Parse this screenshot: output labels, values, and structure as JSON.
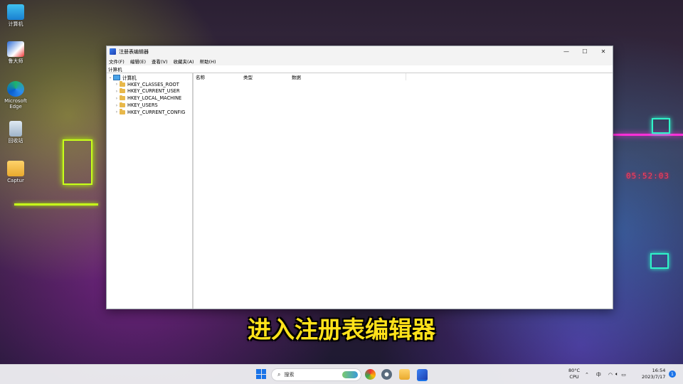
{
  "desktop": {
    "icons": [
      {
        "label": "计算机"
      },
      {
        "label": "鲁大师"
      },
      {
        "label": "Microsoft Edge"
      },
      {
        "label": "回收站"
      },
      {
        "label": "Captur"
      }
    ],
    "neon_clock": "05:52:03"
  },
  "window": {
    "title": "注册表编辑器",
    "controls": {
      "minimize": "—",
      "maximize": "☐",
      "close": "✕"
    },
    "menu": [
      "文件(F)",
      "编辑(E)",
      "查看(V)",
      "收藏夹(A)",
      "帮助(H)"
    ],
    "address": "计算机",
    "tree": {
      "root": "计算机",
      "children": [
        "HKEY_CLASSES_ROOT",
        "HKEY_CURRENT_USER",
        "HKEY_LOCAL_MACHINE",
        "HKEY_USERS",
        "HKEY_CURRENT_CONFIG"
      ]
    },
    "columns": [
      "名称",
      "类型",
      "数据"
    ]
  },
  "subtitle": "进入注册表编辑器",
  "taskbar": {
    "search_placeholder": "搜索",
    "cpu_temp": "80°C",
    "cpu_label": "CPU",
    "ime": "中",
    "time": "16:54",
    "date": "2023/7/17",
    "notification_count": "1"
  }
}
